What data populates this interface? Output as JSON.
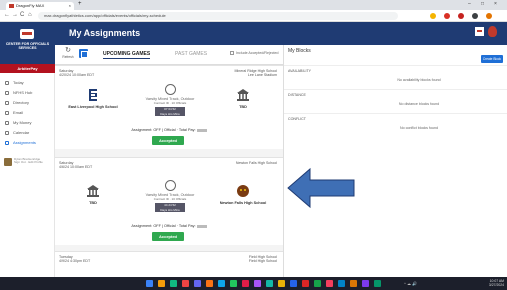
{
  "browser": {
    "tab_title": "DragonFly MAX",
    "url": "max.dragonflyathletics.com/app/officials/events/officials/my-schedule",
    "close_tab": "×",
    "new_tab": "+",
    "back": "←",
    "forward": "→",
    "reload": "C",
    "home": "⌂",
    "window_min": "–",
    "window_max": "□",
    "window_close": "×"
  },
  "sidebar": {
    "logo_text": "CENTER FOR OFFICIALS SERVICES",
    "brand": "ArbiterPay",
    "items": [
      {
        "label": "Today"
      },
      {
        "label": "NFHS Hub"
      },
      {
        "label": "Directory"
      },
      {
        "label": "Email"
      },
      {
        "label": "My Money"
      },
      {
        "label": "Calendar"
      },
      {
        "label": "Assignments"
      }
    ],
    "user_line1": "Dylan Breckenridge",
    "user_line2": "Sign Out · Edit Profile"
  },
  "header": {
    "title": "My Assignments"
  },
  "controls": {
    "refresh_label": "Refresh",
    "refresh_icon": "↻",
    "tab_upcoming": "UPCOMING GAMES",
    "tab_past": "PAST GAMES",
    "include_label": "Include Accepted/Rejected"
  },
  "games": [
    {
      "date": "Saturday",
      "time": "4/20/24 10:00am EDT",
      "location": "Mineral Ridge High School",
      "sublocation": "Lee Lane Stadium",
      "home_team": "East Liverpool High School",
      "away_team": "TBD",
      "sport": "Varsity Mixed Track, Outdoor",
      "contract": "Contract ID · 10 Officials",
      "countdown_top": "07  04  52",
      "countdown_bottom": "Days  Hrs  Mins",
      "assignment": "Assignment: OFF | Official · Total Pay:",
      "status": "Accepted"
    },
    {
      "date": "Saturday",
      "time": "4/6/24 10:00am EDT",
      "location": "Newton Falls High School",
      "sublocation": "",
      "home_team": "TBD",
      "away_team": "Newton Falls High School",
      "sport": "Varsity Mixed Track, Outdoor",
      "contract": "Contract ID · 10 Officials",
      "countdown_top": "44  24  52",
      "countdown_bottom": "Days  Hrs  Mins",
      "assignment": "Assignment: OFF | Official · Total Pay:",
      "status": "Accepted"
    },
    {
      "date": "Tuesday",
      "time": "4/9/24 4:30pm EDT",
      "location": "Field High School",
      "sublocation": "Field High School"
    }
  ],
  "blocks": {
    "title": "My Blocks",
    "new_button": "Create Block",
    "sections": [
      {
        "label": "AVAILABILITY",
        "empty": "No availability blocks found"
      },
      {
        "label": "DISTANCE",
        "empty": "No distance blocks found"
      },
      {
        "label": "CONFLICT",
        "empty": "No conflict blocks found"
      }
    ]
  },
  "taskbar": {
    "tray": "^  ☁  🔊",
    "time": "10:07 AM",
    "date": "3/27/2024"
  },
  "colors": {
    "navy": "#1f3b73",
    "accent_blue": "#1f6fd6",
    "accepted_green": "#2fa84f",
    "arbiter_red": "#b3121f",
    "arrow_blue": "#3f6fb5"
  }
}
